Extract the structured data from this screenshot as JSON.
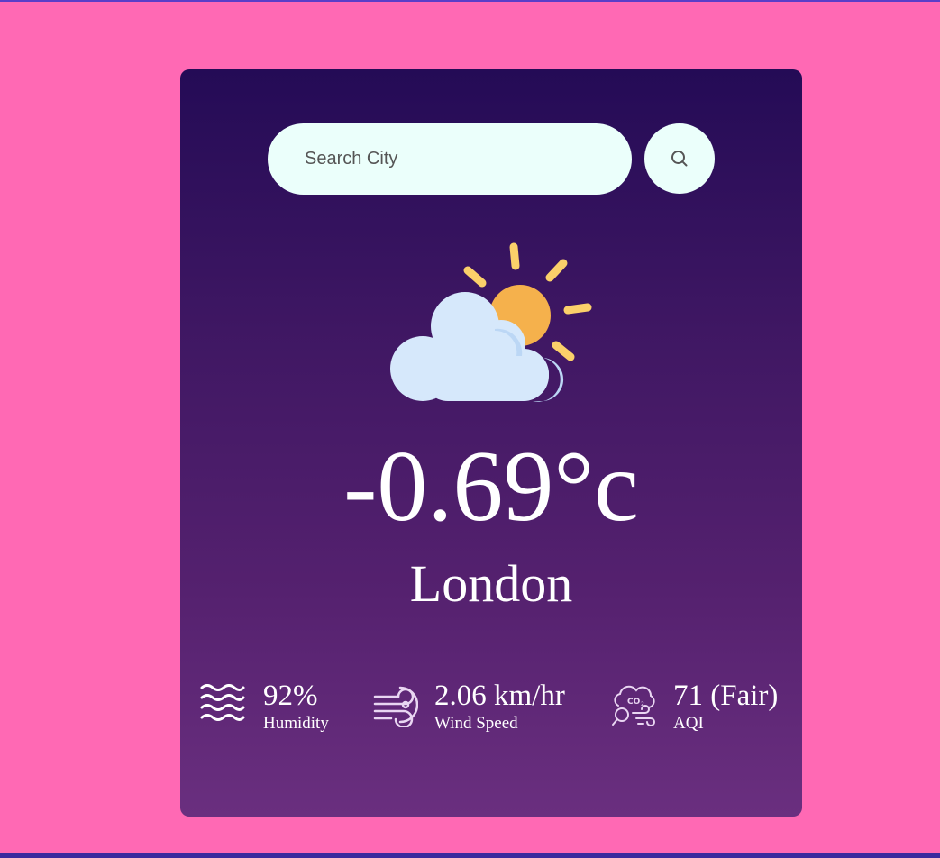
{
  "search": {
    "placeholder": "Search City",
    "button_icon": "search-icon"
  },
  "weather": {
    "icon": "partly-cloudy-icon",
    "temperature": "-0.69°c",
    "city": "London"
  },
  "stats": {
    "humidity": {
      "icon": "humidity-waves-icon",
      "value": "92%",
      "label": "Humidity"
    },
    "wind": {
      "icon": "wind-icon",
      "value": "2.06 km/hr",
      "label": "Wind Speed"
    },
    "aqi": {
      "icon": "co2-air-quality-icon",
      "value": "71 (Fair)",
      "label": "AQI"
    }
  },
  "colors": {
    "page_background": "#ff69b4",
    "card_gradient_top": "#240b56",
    "card_gradient_bottom": "#6a2f7f",
    "search_background": "#ebfffb",
    "sun": "#f5b14c",
    "sun_rays": "#fbd06a",
    "cloud": "#d6e8fb",
    "text": "#ffffff"
  }
}
